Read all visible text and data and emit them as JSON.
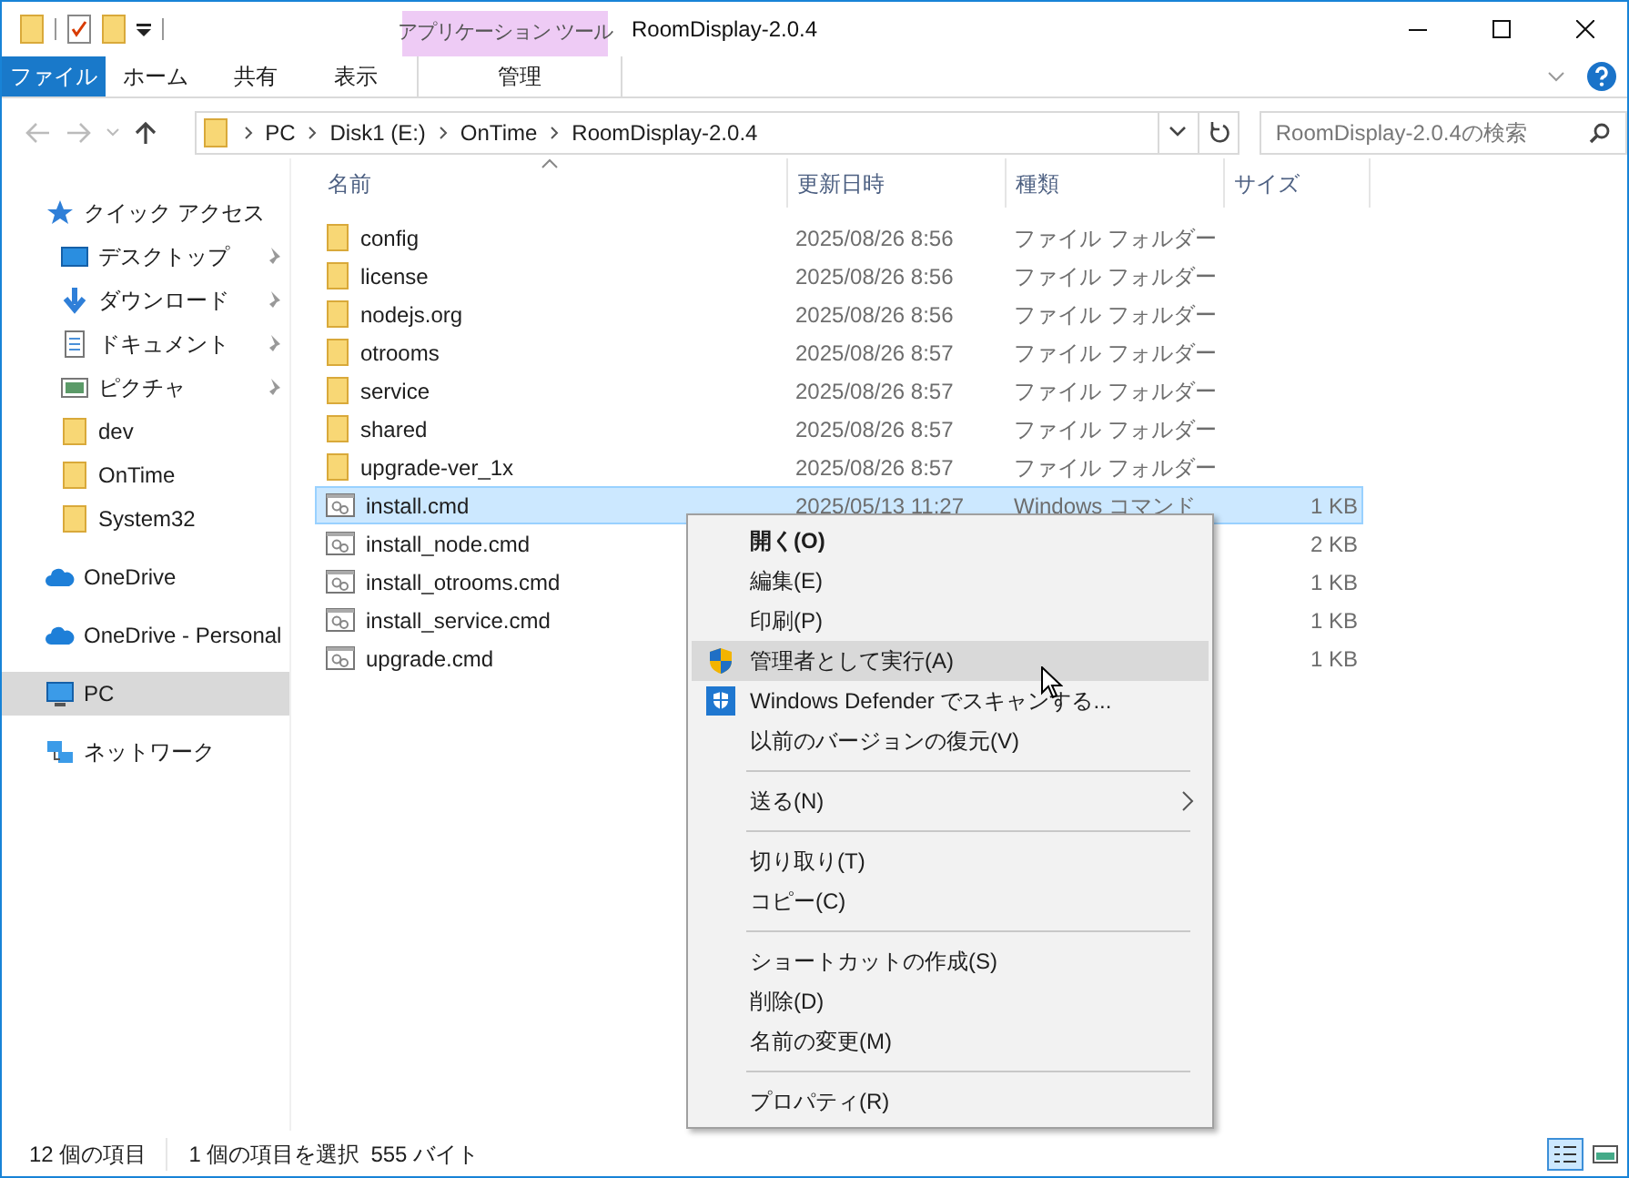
{
  "window": {
    "title": "RoomDisplay-2.0.4",
    "context_tab_group": "アプリケーション ツール"
  },
  "ribbon_tabs": [
    {
      "label": "ファイル",
      "kind": "file"
    },
    {
      "label": "ホーム",
      "kind": "normal"
    },
    {
      "label": "共有",
      "kind": "normal"
    },
    {
      "label": "表示",
      "kind": "normal"
    },
    {
      "label": "管理",
      "kind": "contextual"
    }
  ],
  "address": {
    "crumbs": [
      "PC",
      "Disk1 (E:)",
      "OnTime",
      "RoomDisplay-2.0.4"
    ]
  },
  "search": {
    "placeholder": "RoomDisplay-2.0.4の検索"
  },
  "sidebar": {
    "items": [
      {
        "label": "クイック アクセス",
        "kind": "star",
        "selected": false,
        "children": [
          {
            "label": "デスクトップ",
            "kind": "desktop",
            "pinned": true,
            "selected": false
          },
          {
            "label": "ダウンロード",
            "kind": "download",
            "pinned": true,
            "selected": false
          },
          {
            "label": "ドキュメント",
            "kind": "document",
            "pinned": true,
            "selected": false
          },
          {
            "label": "ピクチャ",
            "kind": "picture",
            "pinned": true,
            "selected": false
          },
          {
            "label": "dev",
            "kind": "folder",
            "pinned": false,
            "selected": false
          },
          {
            "label": "OnTime",
            "kind": "folder",
            "pinned": false,
            "selected": false
          },
          {
            "label": "System32",
            "kind": "folder",
            "pinned": false,
            "selected": false
          }
        ]
      },
      {
        "label": "OneDrive",
        "kind": "cloud",
        "selected": false
      },
      {
        "label": "OneDrive - Personal",
        "kind": "cloud",
        "selected": false
      },
      {
        "label": "PC",
        "kind": "pc",
        "selected": true
      },
      {
        "label": "ネットワーク",
        "kind": "network",
        "selected": false
      }
    ]
  },
  "columns": [
    "名前",
    "更新日時",
    "種類",
    "サイズ"
  ],
  "rows": [
    {
      "name": "config",
      "modified": "2025/08/26 8:56",
      "type": "ファイル フォルダー",
      "kind": "folder",
      "selected": false
    },
    {
      "name": "license",
      "modified": "2025/08/26 8:56",
      "type": "ファイル フォルダー",
      "kind": "folder",
      "selected": false
    },
    {
      "name": "nodejs.org",
      "modified": "2025/08/26 8:56",
      "type": "ファイル フォルダー",
      "kind": "folder",
      "selected": false
    },
    {
      "name": "otrooms",
      "modified": "2025/08/26 8:57",
      "type": "ファイル フォルダー",
      "kind": "folder",
      "selected": false
    },
    {
      "name": "service",
      "modified": "2025/08/26 8:57",
      "type": "ファイル フォルダー",
      "kind": "folder",
      "selected": false
    },
    {
      "name": "shared",
      "modified": "2025/08/26 8:57",
      "type": "ファイル フォルダー",
      "kind": "folder",
      "selected": false
    },
    {
      "name": "upgrade-ver_1x",
      "modified": "2025/08/26 8:57",
      "type": "ファイル フォルダー",
      "kind": "folder",
      "selected": false
    },
    {
      "name": "install.cmd",
      "modified": "2025/05/13 11:27",
      "type": "Windows コマンド",
      "size": "1 KB",
      "kind": "cmd",
      "selected": true
    },
    {
      "name": "install_node.cmd",
      "size": "2 KB",
      "kind": "cmd",
      "selected": false
    },
    {
      "name": "install_otrooms.cmd",
      "size": "1 KB",
      "kind": "cmd",
      "selected": false
    },
    {
      "name": "install_service.cmd",
      "size": "1 KB",
      "kind": "cmd",
      "selected": false
    },
    {
      "name": "upgrade.cmd",
      "size": "1 KB",
      "kind": "cmd",
      "selected": false
    }
  ],
  "context_menu": {
    "items": [
      {
        "kind": "item",
        "label": "開く(O)",
        "default": true,
        "selected": false,
        "submenu": false
      },
      {
        "kind": "item",
        "label": "編集(E)",
        "default": false,
        "selected": false,
        "submenu": false
      },
      {
        "kind": "item",
        "label": "印刷(P)",
        "default": false,
        "selected": false,
        "submenu": false
      },
      {
        "kind": "admin",
        "label": "管理者として実行(A)",
        "default": false,
        "selected": true,
        "submenu": false
      },
      {
        "kind": "scan",
        "label": "Windows Defender でスキャンする...",
        "default": false,
        "selected": false,
        "submenu": false
      },
      {
        "kind": "item",
        "label": "以前のバージョンの復元(V)",
        "default": false,
        "selected": false,
        "submenu": false
      },
      {
        "kind": "separator"
      },
      {
        "kind": "item",
        "label": "送る(N)",
        "default": false,
        "selected": false,
        "submenu": true
      },
      {
        "kind": "separator"
      },
      {
        "kind": "item",
        "label": "切り取り(T)",
        "default": false,
        "selected": false,
        "submenu": false
      },
      {
        "kind": "item",
        "label": "コピー(C)",
        "default": false,
        "selected": false,
        "submenu": false
      },
      {
        "kind": "separator"
      },
      {
        "kind": "item",
        "label": "ショートカットの作成(S)",
        "default": false,
        "selected": false,
        "submenu": false
      },
      {
        "kind": "item",
        "label": "削除(D)",
        "default": false,
        "selected": false,
        "submenu": false
      },
      {
        "kind": "item",
        "label": "名前の変更(M)",
        "default": false,
        "selected": false,
        "submenu": false
      },
      {
        "kind": "separator"
      },
      {
        "kind": "item",
        "label": "プロパティ(R)",
        "default": false,
        "selected": false,
        "submenu": false
      }
    ]
  },
  "status_bar": {
    "item_count": "12 個の項目",
    "selection": "1 個の項目を選択",
    "size": "555 バイト"
  },
  "view_buttons": [
    {
      "kind": "details",
      "selected": true
    },
    {
      "kind": "large-icons",
      "selected": false
    }
  ]
}
